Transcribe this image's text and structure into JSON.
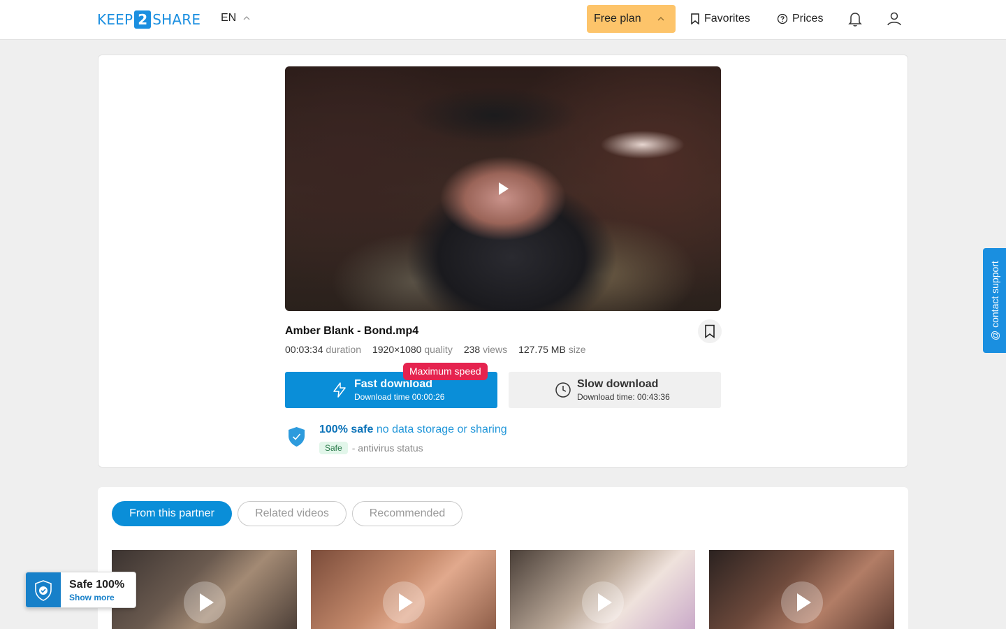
{
  "header": {
    "logo_left": "KEEP",
    "logo_mid": "2",
    "logo_right": "SHARE",
    "language": "EN",
    "plan_label": "Free plan",
    "favorites_label": "Favorites",
    "prices_label": "Prices"
  },
  "file": {
    "title": "Amber Blank - Bond.mp4",
    "duration_value": "00:03:34",
    "duration_unit": "duration",
    "quality_value": "1920×1080",
    "quality_unit": "quality",
    "views_value": "238",
    "views_unit": "views",
    "size_value": "127.75 MB",
    "size_unit": "size"
  },
  "download": {
    "fast_label": "Fast download",
    "fast_time": "Download time 00:00:26",
    "speed_badge": "Maximum speed",
    "slow_label": "Slow download",
    "slow_time": "Download time: 00:43:36"
  },
  "safety": {
    "headline": "100% safe",
    "subline": "no data storage or sharing",
    "av_badge": "Safe",
    "av_text": "- antivirus status"
  },
  "tabs": [
    {
      "label": "From this partner",
      "active": true
    },
    {
      "label": "Related videos",
      "active": false
    },
    {
      "label": "Recommended",
      "active": false
    }
  ],
  "widget": {
    "title": "Safe 100%",
    "link": "Show more"
  },
  "support": {
    "label": "@ contact support"
  },
  "colors": {
    "brand": "#1b8fe0",
    "primary_button": "#0a8ed8",
    "plan_button": "#fdc46a",
    "badge_red": "#e5234f"
  }
}
